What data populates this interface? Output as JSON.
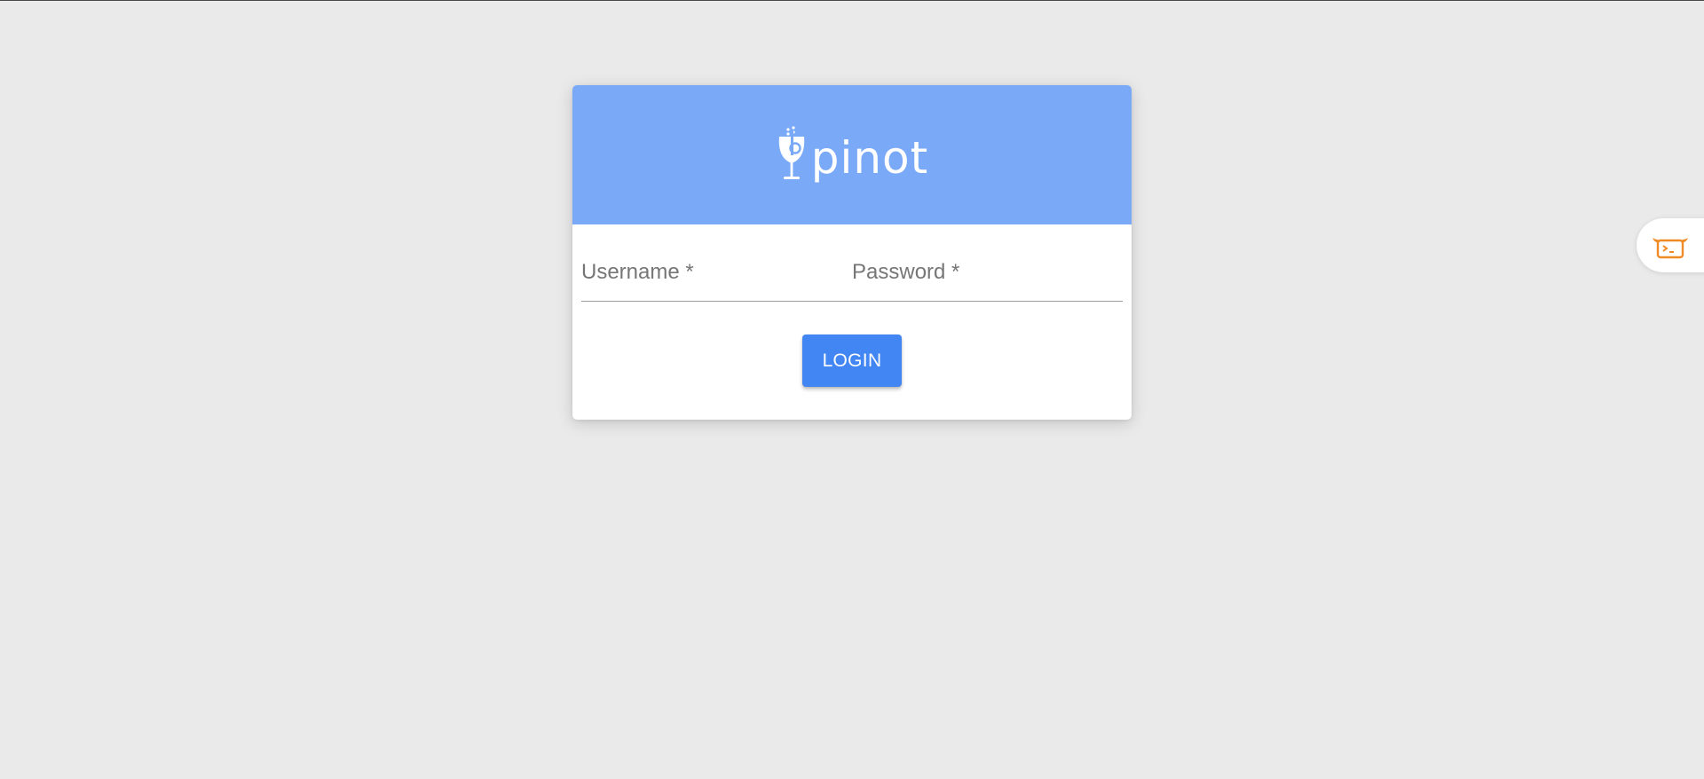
{
  "brand": {
    "name": "pinot",
    "header_color": "#7aa9f8",
    "logo_icon": "wine-glass-icon"
  },
  "form": {
    "username_label": "Username *",
    "password_label": "Password *",
    "login_label": "LOGIN"
  },
  "side_widget": {
    "icon": "terminal-bot-icon",
    "accent": "#f08a24"
  },
  "colors": {
    "page_background": "#eaeaea",
    "button": "#4286f4"
  }
}
